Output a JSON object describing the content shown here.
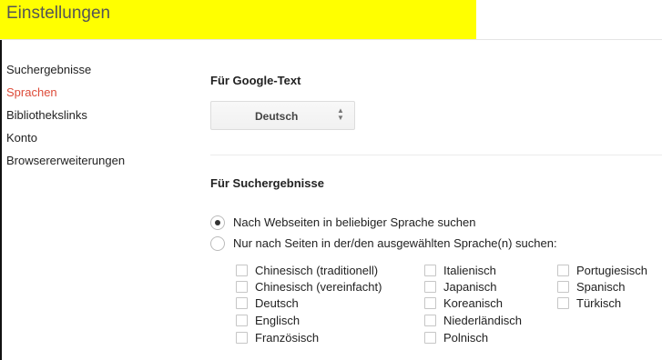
{
  "header": {
    "title": "Einstellungen",
    "highlight_color": "#ffff00"
  },
  "sidebar": {
    "items": [
      {
        "label": "Suchergebnisse"
      },
      {
        "label": "Sprachen",
        "active": true
      },
      {
        "label": "Bibliothekslinks"
      },
      {
        "label": "Konto"
      },
      {
        "label": "Browsererweiterungen"
      }
    ],
    "active_color": "#dd4b39"
  },
  "google_text": {
    "title": "Für Google-Text",
    "selected_language": "Deutsch"
  },
  "search_results": {
    "title": "Für Suchergebnisse",
    "radio_any": {
      "label": "Nach Webseiten in beliebiger Sprache suchen",
      "checked": true
    },
    "radio_selected": {
      "label": "Nur nach Seiten in der/den ausgewählten Sprache(n) suchen:",
      "checked": false
    },
    "languages": {
      "col1": [
        "Chinesisch (traditionell)",
        "Chinesisch (vereinfacht)",
        "Deutsch",
        "Englisch",
        "Französisch"
      ],
      "col2": [
        "Italienisch",
        "Japanisch",
        "Koreanisch",
        "Niederländisch",
        "Polnisch"
      ],
      "col3": [
        "Portugiesisch",
        "Spanisch",
        "Türkisch"
      ]
    }
  }
}
